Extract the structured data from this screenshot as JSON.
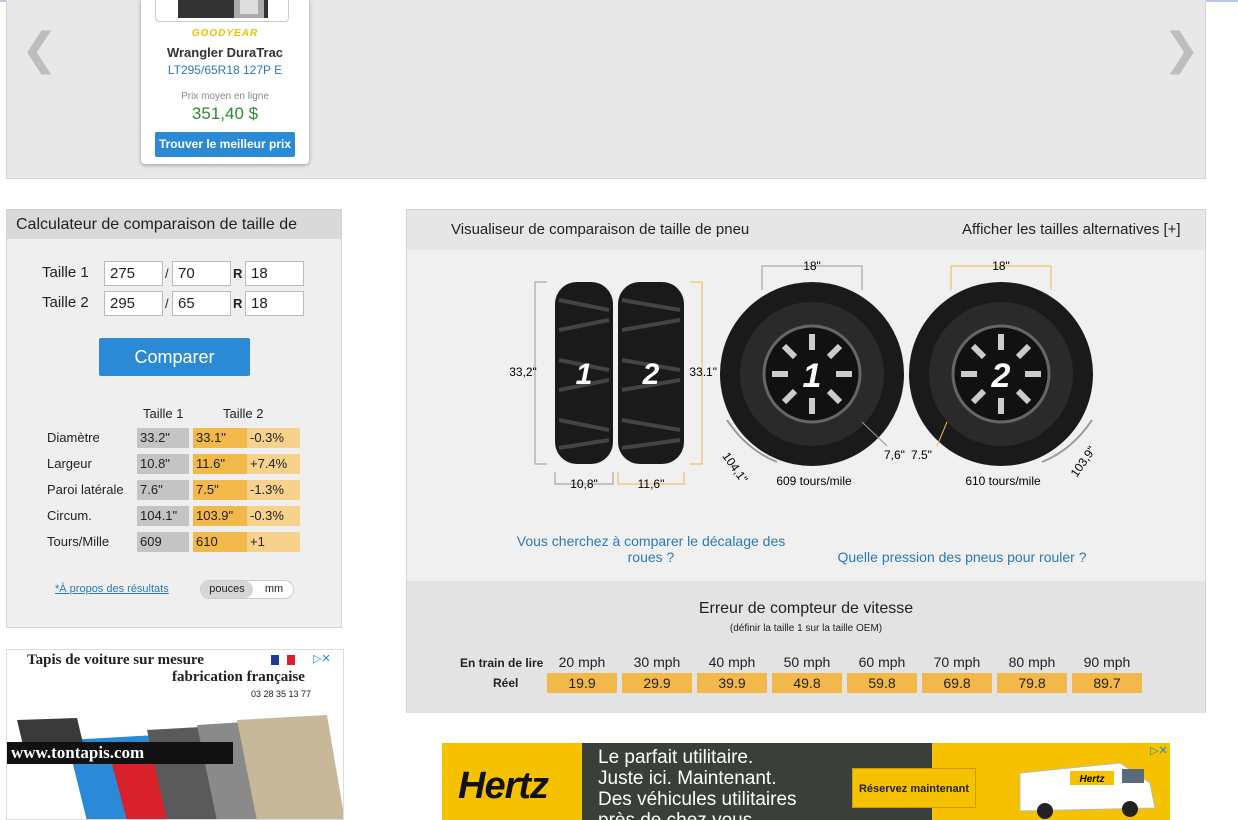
{
  "carousel": {
    "prev_icon": "chevron-left-icon",
    "next_icon": "chevron-right-icon",
    "card": {
      "brand": "GOODYEAR",
      "model": "Wrangler DuraTrac",
      "size": "LT295/65R18 127P E",
      "price_label": "Prix moyen en ligne",
      "price": "351,40 $",
      "button": "Trouver le meilleur prix"
    }
  },
  "calculator": {
    "title": "Calculateur de comparaison de taille de",
    "size1": {
      "label": "Taille 1",
      "width": "275",
      "ratio": "70",
      "rim": "18"
    },
    "size2": {
      "label": "Taille 2",
      "width": "295",
      "ratio": "65",
      "rim": "18"
    },
    "slash": "/",
    "r": "R",
    "compare_button": "Comparer",
    "col1": "Taille 1",
    "col2": "Taille 2",
    "rows": [
      {
        "name": "Diamètre",
        "v1": "33.2\"",
        "v2": "33.1\"",
        "diff": "-0.3%"
      },
      {
        "name": "Largeur",
        "v1": "10.8\"",
        "v2": "11.6\"",
        "diff": "+7.4%"
      },
      {
        "name": "Paroi latérale",
        "v1": "7.6\"",
        "v2": "7.5\"",
        "diff": "-1.3%"
      },
      {
        "name": "Circum.",
        "v1": "104.1\"",
        "v2": "103.9\"",
        "diff": "-0.3%"
      },
      {
        "name": "Tours/Mille",
        "v1": "609",
        "v2": "610",
        "diff": "+1"
      }
    ],
    "about_link": "*À propos des résultats",
    "unit_inches": "pouces",
    "unit_mm": "mm"
  },
  "ad_carpet": {
    "line1": "Tapis de voiture sur mesure",
    "line2": "fabrication française",
    "phone": "03 28 35 13 77",
    "url": "www.tontapis.com"
  },
  "visualizer": {
    "title": "Visualiseur de comparaison de taille de pneu",
    "alt_link": "Afficher les tailles alternatives [+]",
    "tire1_label": "1",
    "tire2_label": "2",
    "diam1": "33,2\"",
    "diam2": "33.1\"",
    "width1": "10,8\"",
    "width2": "11,6\"",
    "rim1": "18\"",
    "rim2": "18\"",
    "side1": "7,6\"",
    "side2": "7.5\"",
    "circ1": "104,1\"",
    "circ2": "103,9\"",
    "rev1": "609 tours/mile",
    "rev2": "610 tours/mile",
    "offset_link": "Vous cherchez à comparer le décalage des roues ?",
    "pressure_link": "Quelle pression des pneus pour rouler ?"
  },
  "speedometer": {
    "title": "Erreur de compteur de vitesse",
    "subtitle": "(définir la taille 1 sur la taille OEM)",
    "reading_label": "En train de lire",
    "actual_label": "Réel",
    "readings": [
      "20 mph",
      "30 mph",
      "40 mph",
      "50 mph",
      "60 mph",
      "70 mph",
      "80 mph",
      "90 mph"
    ],
    "actual": [
      "19.9",
      "29.9",
      "39.9",
      "49.8",
      "59.8",
      "69.8",
      "79.8",
      "89.7"
    ]
  },
  "ad_hertz": {
    "logo": "Hertz",
    "msg1": "Le parfait utilitaire.",
    "msg2": "Juste ici. Maintenant.",
    "msg3": "Des véhicules utilitaires",
    "msg4": "près de chez vous",
    "cta": "Réservez maintenant",
    "van_logo": "Hertz"
  },
  "colors": {
    "accent": "#2b8ad6",
    "highlight": "#f2b84a",
    "link": "#2a7ab8",
    "price": "#2d8a2d"
  }
}
